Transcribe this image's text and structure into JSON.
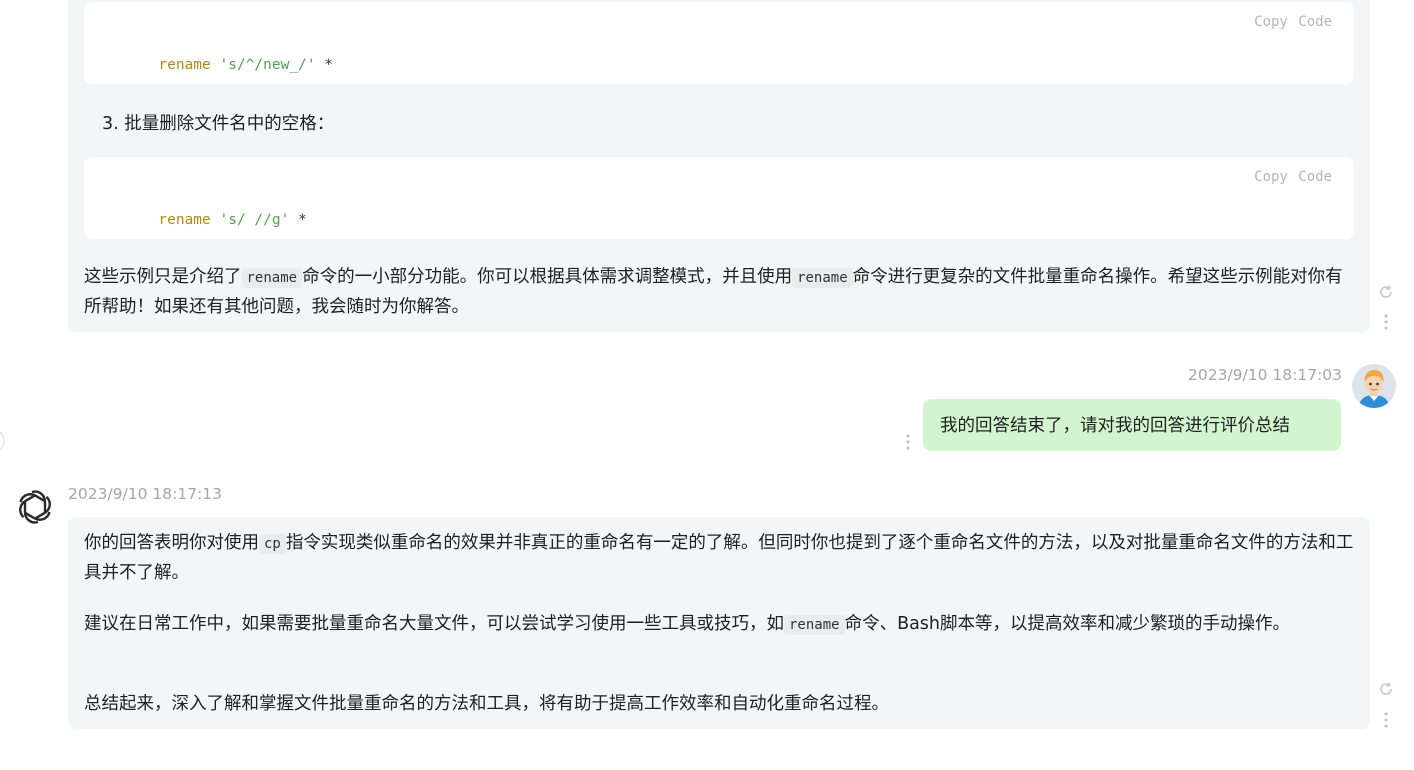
{
  "copy_code_label": "Copy  Code",
  "code_blocks": [
    {
      "cmd": "rename",
      "arg": "'s/^/new_/'",
      "rest": "*"
    },
    {
      "cmd": "rename",
      "arg": "'s/ //g'",
      "rest": "*"
    }
  ],
  "list_item_3": "3. 批量删除文件名中的空格：",
  "message1": {
    "p1_a": "这些示例只是介绍了",
    "p1_code1": "rename",
    "p1_b": "命令的一小部分功能。你可以根据具体需求调整模式，并且使用",
    "p1_code2": "rename",
    "p1_c": "命令进行更复杂的文件批量重命名操作。希望这些示例能对你有所帮助！如果还有其他问题，我会随时为你解答。"
  },
  "user_message": {
    "timestamp": "2023/9/10 18:17:03",
    "text": "我的回答结束了，请对我的回答进行评价总结"
  },
  "assistant_message": {
    "timestamp": "2023/9/10 18:17:13",
    "p1_a": "你的回答表明你对使用",
    "p1_code": "cp",
    "p1_b": "指令实现类似重命名的效果并非真正的重命名有一定的了解。但同时你也提到了逐个重命名文件的方法，以及对批量重命名文件的方法和工具并不了解。",
    "p2_a": "建议在日常工作中，如果需要批量重命名大量文件，可以尝试学习使用一些工具或技巧，如",
    "p2_code": "rename",
    "p2_b": "命令、Bash脚本等，以提高效率和减少繁琐的手动操作。",
    "p3": "总结起来，深入了解和掌握文件批量重命名的方法和工具，将有助于提高工作效率和自动化重命名过程。"
  },
  "icons": {
    "regenerate": "refresh-icon",
    "more": "more-vertical-icon",
    "assistant_avatar": "openai-logo-icon",
    "user_avatar": "user-avatar"
  }
}
